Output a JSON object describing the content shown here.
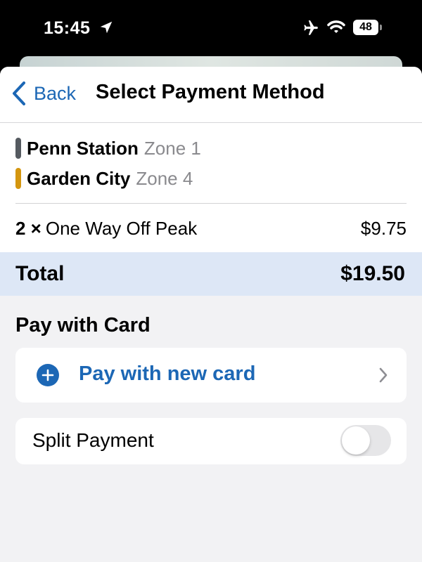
{
  "status_bar": {
    "time": "15:45",
    "battery": "48",
    "icons": [
      "location-arrow-icon",
      "airplane-mode-icon",
      "wifi-icon",
      "battery-icon"
    ]
  },
  "nav": {
    "back_label": "Back",
    "title": "Select Payment Method"
  },
  "trip": {
    "origin": {
      "name": "Penn Station",
      "zone": "Zone 1",
      "color": "#555a60"
    },
    "destination": {
      "name": "Garden City",
      "zone": "Zone 4",
      "color": "#d4960f"
    }
  },
  "fare": {
    "quantity": "2 ×",
    "type": "One Way Off Peak",
    "price": "$9.75"
  },
  "total": {
    "label": "Total",
    "amount": "$19.50"
  },
  "payment": {
    "section_title": "Pay with Card",
    "new_card_label": "Pay with new card",
    "split_label": "Split Payment",
    "split_enabled": false
  },
  "colors": {
    "accent": "#1c67b5",
    "total_background": "#dde7f6",
    "page_background": "#f2f2f4"
  }
}
